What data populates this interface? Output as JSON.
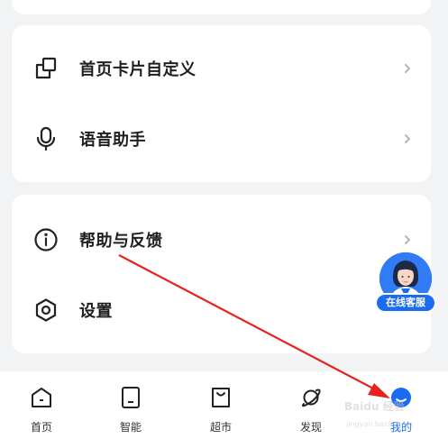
{
  "menu_group_1": {
    "items": [
      {
        "label": "首页卡片自定义",
        "icon": "card-customize-icon"
      },
      {
        "label": "语音助手",
        "icon": "microphone-icon"
      }
    ]
  },
  "menu_group_2": {
    "items": [
      {
        "label": "帮助与反馈",
        "icon": "info-icon"
      },
      {
        "label": "设置",
        "icon": "settings-hexagon-icon"
      }
    ]
  },
  "floating_service": {
    "label": "在线客服",
    "icon": "customer-service-avatar"
  },
  "tabbar": {
    "tabs": [
      {
        "label": "首页",
        "icon": "home-icon",
        "active": false
      },
      {
        "label": "智能",
        "icon": "device-icon",
        "active": false
      },
      {
        "label": "超市",
        "icon": "shopping-bag-icon",
        "active": false
      },
      {
        "label": "发现",
        "icon": "planet-icon",
        "active": false
      },
      {
        "label": "我的",
        "icon": "profile-icon",
        "active": true
      }
    ]
  },
  "watermark": {
    "text": "Baidu 经验",
    "url": "jingyan.baidu.com"
  },
  "colors": {
    "accent": "#1a6cf0",
    "background": "#f2f3f5",
    "annotation_arrow": "#e8231f"
  }
}
